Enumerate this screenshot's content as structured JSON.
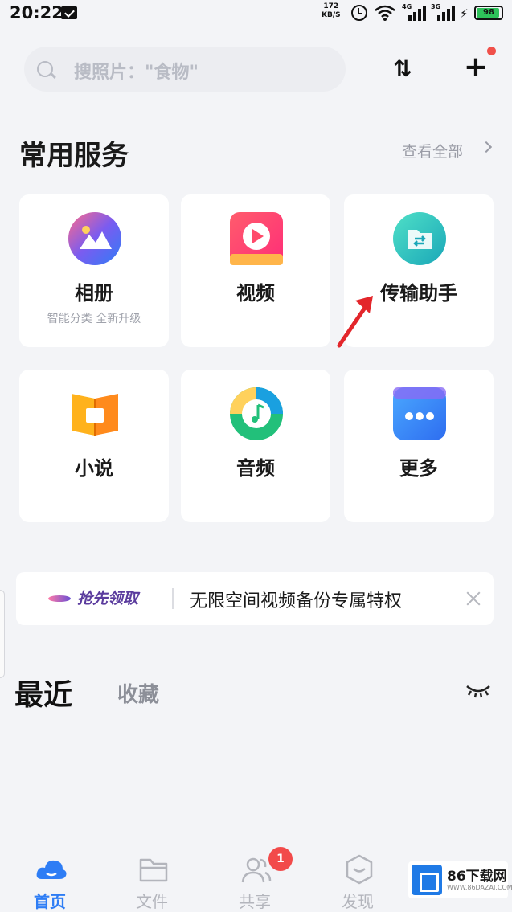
{
  "status_bar": {
    "time": "20:22",
    "net_speed_value": "172",
    "net_speed_unit": "KB/S",
    "sim1_label": "4G",
    "sim2_label": "3G",
    "battery_level": "98"
  },
  "search": {
    "placeholder": "搜照片：\"食物\""
  },
  "services": {
    "title": "常用服务",
    "view_all": "查看全部",
    "items": [
      {
        "label": "相册",
        "subtitle": "智能分类 全新升级",
        "icon": "album-icon"
      },
      {
        "label": "视频",
        "icon": "video-icon"
      },
      {
        "label": "传输助手",
        "icon": "transfer-icon"
      },
      {
        "label": "小说",
        "icon": "novel-icon"
      },
      {
        "label": "音频",
        "icon": "audio-icon"
      },
      {
        "label": "更多",
        "icon": "more-icon"
      }
    ]
  },
  "banner": {
    "logo": "抢先领取",
    "text": "无限空间视频备份专属特权"
  },
  "recent": {
    "tabs": [
      {
        "label": "最近",
        "active": true
      },
      {
        "label": "收藏",
        "active": false
      }
    ]
  },
  "bottom_nav": {
    "items": [
      {
        "label": "首页",
        "active": true
      },
      {
        "label": "文件",
        "active": false
      },
      {
        "label": "共享",
        "active": false,
        "badge": "1"
      },
      {
        "label": "发现",
        "active": false
      }
    ]
  },
  "watermark": {
    "title": "86下载网",
    "subtitle": "WWW.86DAZAI.COM"
  },
  "colors": {
    "accent": "#2e7df5",
    "badge": "#f24a4a",
    "background": "#f3f4f7"
  }
}
